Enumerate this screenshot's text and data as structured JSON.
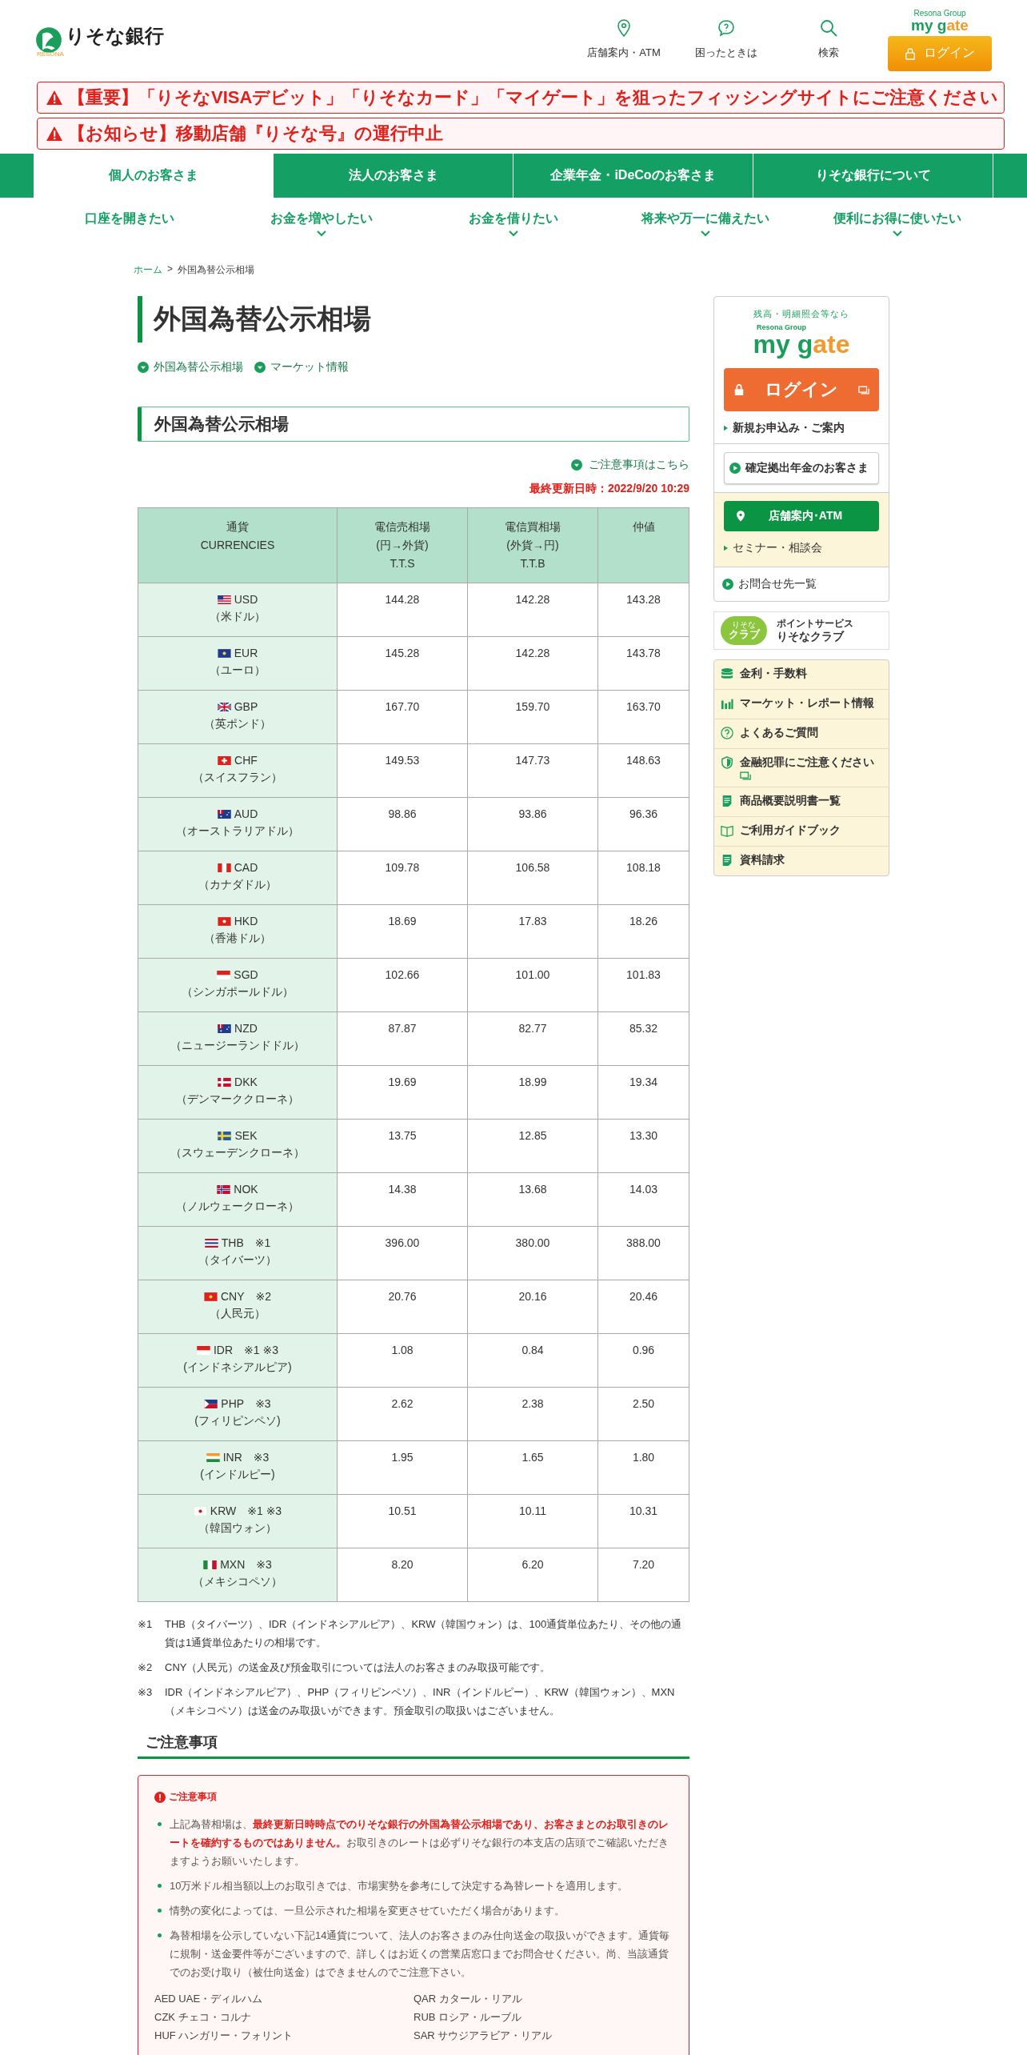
{
  "header": {
    "logo_text": "りそな銀行",
    "logo_sub": "RESONA",
    "utility_links": [
      {
        "label": "店舗案内・ATM",
        "kind": "pin"
      },
      {
        "label": "困ったときは",
        "kind": "help"
      },
      {
        "label": "検索",
        "kind": "search"
      }
    ],
    "mygate_group": "Resona Group",
    "mygate_logo_a": "my g",
    "mygate_logo_b": "ate",
    "login": "ログイン"
  },
  "alerts": [
    "【重要】「りそなVISAデビット」「りそなカード」「マイゲート」を狙ったフィッシングサイトにご注意ください",
    "【お知らせ】移動店舗『りそな号』の運行中止"
  ],
  "tabs": [
    {
      "label": "個人のお客さま",
      "selected": true
    },
    {
      "label": "法人のお客さま",
      "selected": false
    },
    {
      "label": "企業年金・iDeCoのお客さま",
      "selected": false
    },
    {
      "label": "りそな銀行について",
      "selected": false
    }
  ],
  "subnav": [
    {
      "label": "口座を開きたい",
      "dropdown": false
    },
    {
      "label": "お金を増やしたい",
      "dropdown": true
    },
    {
      "label": "お金を借りたい",
      "dropdown": true
    },
    {
      "label": "将来や万一に備えたい",
      "dropdown": true
    },
    {
      "label": "便利にお得に使いたい",
      "dropdown": true
    }
  ],
  "breadcrumb": {
    "home": "ホーム",
    "separator": ">",
    "current": "外国為替公示相場"
  },
  "page_title": "外国為替公示相場",
  "anchor_links": [
    "外国為替公示相場",
    "マーケット情報"
  ],
  "section_title": "外国為替公示相場",
  "notes_link": "ご注意事項はこちら",
  "updated": "最終更新日時：2022/9/20 10:29",
  "table": {
    "columns": [
      [
        "通貨",
        "CURRENCIES"
      ],
      [
        "電信売相場",
        "(円→外貨)",
        "T.T.S"
      ],
      [
        "電信買相場",
        "(外貨→円)",
        "T.T.B"
      ],
      [
        "仲値"
      ]
    ],
    "rows": [
      {
        "code": "USD",
        "note": "",
        "name": "（米ドル）",
        "tts": "144.28",
        "ttb": "142.28",
        "mid": "143.28"
      },
      {
        "code": "EUR",
        "note": "",
        "name": "（ユーロ）",
        "tts": "145.28",
        "ttb": "142.28",
        "mid": "143.78"
      },
      {
        "code": "GBP",
        "note": "",
        "name": "（英ポンド）",
        "tts": "167.70",
        "ttb": "159.70",
        "mid": "163.70"
      },
      {
        "code": "CHF",
        "note": "",
        "name": "（スイスフラン）",
        "tts": "149.53",
        "ttb": "147.73",
        "mid": "148.63"
      },
      {
        "code": "AUD",
        "note": "",
        "name": "（オーストラリアドル）",
        "tts": "98.86",
        "ttb": "93.86",
        "mid": "96.36"
      },
      {
        "code": "CAD",
        "note": "",
        "name": "（カナダドル）",
        "tts": "109.78",
        "ttb": "106.58",
        "mid": "108.18"
      },
      {
        "code": "HKD",
        "note": "",
        "name": "（香港ドル）",
        "tts": "18.69",
        "ttb": "17.83",
        "mid": "18.26"
      },
      {
        "code": "SGD",
        "note": "",
        "name": "（シンガポールドル）",
        "tts": "102.66",
        "ttb": "101.00",
        "mid": "101.83"
      },
      {
        "code": "NZD",
        "note": "",
        "name": "（ニュージーランドドル）",
        "tts": "87.87",
        "ttb": "82.77",
        "mid": "85.32"
      },
      {
        "code": "DKK",
        "note": "",
        "name": "（デンマーククローネ）",
        "tts": "19.69",
        "ttb": "18.99",
        "mid": "19.34"
      },
      {
        "code": "SEK",
        "note": "",
        "name": "（スウェーデンクローネ）",
        "tts": "13.75",
        "ttb": "12.85",
        "mid": "13.30"
      },
      {
        "code": "NOK",
        "note": "",
        "name": "（ノルウェークローネ）",
        "tts": "14.38",
        "ttb": "13.68",
        "mid": "14.03"
      },
      {
        "code": "THB",
        "note": "※1",
        "name": "（タイバーツ）",
        "tts": "396.00",
        "ttb": "380.00",
        "mid": "388.00"
      },
      {
        "code": "CNY",
        "note": "※2",
        "name": "（人民元）",
        "tts": "20.76",
        "ttb": "20.16",
        "mid": "20.46"
      },
      {
        "code": "IDR",
        "note": "※1 ※3",
        "name": "(インドネシアルピア)",
        "tts": "1.08",
        "ttb": "0.84",
        "mid": "0.96"
      },
      {
        "code": "PHP",
        "note": "※3",
        "name": "(フィリピンペソ)",
        "tts": "2.62",
        "ttb": "2.38",
        "mid": "2.50"
      },
      {
        "code": "INR",
        "note": "※3",
        "name": "(インドルピー)",
        "tts": "1.95",
        "ttb": "1.65",
        "mid": "1.80"
      },
      {
        "code": "KRW",
        "note": "※1 ※3",
        "name": "（韓国ウォン）",
        "tts": "10.51",
        "ttb": "10.11",
        "mid": "10.31"
      },
      {
        "code": "MXN",
        "note": "※3",
        "name": "（メキシコペソ）",
        "tts": "8.20",
        "ttb": "6.20",
        "mid": "7.20"
      }
    ]
  },
  "footnotes": [
    {
      "mark": "※1",
      "text": "THB（タイバーツ）、IDR（インドネシアルピア）、KRW（韓国ウォン）は、100通貨単位あたり、その他の通貨は1通貨単位あたりの相場です。"
    },
    {
      "mark": "※2",
      "text": "CNY（人民元）の送金及び預金取引については法人のお客さまのみ取扱可能です。"
    },
    {
      "mark": "※3",
      "text": "IDR（インドネシアルピア）、PHP（フィリピンペソ）、INR（インドルピー）、KRW（韓国ウォン）、MXN（メキシコペソ）は送金のみ取扱いができます。預金取引の取扱いはございません。"
    }
  ],
  "notice": {
    "heading": "ご注意事項",
    "box_title": "ご注意事項",
    "bullets": [
      "上記為替相場は、**最終更新日時時点でのりそな銀行の外国為替公示相場であり、お客さまとのお取引きのレートを確約するものではありません。**お取引きのレートは必ずりそな銀行の本支店の店頭でご確認いただきますようお願いいたします。",
      "10万米ドル相当額以上のお取引きでは、市場実勢を参考にして決定する為替レートを適用します。",
      "情勢の変化によっては、一旦公示された相場を変更させていただく場合があります。",
      "為替相場を公示していない下記14通貨について、法人のお客さまのみ仕向送金の取扱いができます。通貨毎に規制・送金要件等がございますので、詳しくはお近くの営業店窓口までお問合せください。尚、当該通貨でのお受け取り（被仕向送金）はできませんのでご注意下さい。"
    ],
    "currencies": [
      "AED UAE・ディルハム",
      "QAR カタール・リアル",
      "CZK チェコ・コルナ",
      "RUB ロシア・ルーブル",
      "HUF ハンガリー・フォリント",
      "SAR サウジアラビア・リアル"
    ]
  },
  "sidebar": {
    "mygate_caption": "残高・明細照会等なら",
    "mygate_group": "Resona Group",
    "mygate_logo_a": "my g",
    "mygate_logo_b": "ate",
    "login": "ログイン",
    "apply_link": "新規お申込み・ご案内",
    "dc_button": "確定拠出年金のお客さま",
    "store_button": "店舗案内･ATM",
    "seminar_link": "セミナー・相談会",
    "contact_link": "お問合せ先一覧",
    "club": {
      "badge_top": "りそな",
      "badge": "クラブ",
      "caption": "ポイントサービス",
      "name": "りそなクラブ"
    },
    "menu": [
      {
        "label": "金利・手数料",
        "kind": "coins",
        "external": false
      },
      {
        "label": "マーケット・レポート情報",
        "kind": "chart",
        "external": false
      },
      {
        "label": "よくあるご質問",
        "kind": "help",
        "external": false
      },
      {
        "label": "金融犯罪にご注意ください",
        "kind": "shield",
        "external": true
      },
      {
        "label": "商品概要説明書一覧",
        "kind": "doc",
        "external": false
      },
      {
        "label": "ご利用ガイドブック",
        "kind": "book",
        "external": false
      },
      {
        "label": "資料請求",
        "kind": "doc",
        "external": false
      }
    ]
  }
}
